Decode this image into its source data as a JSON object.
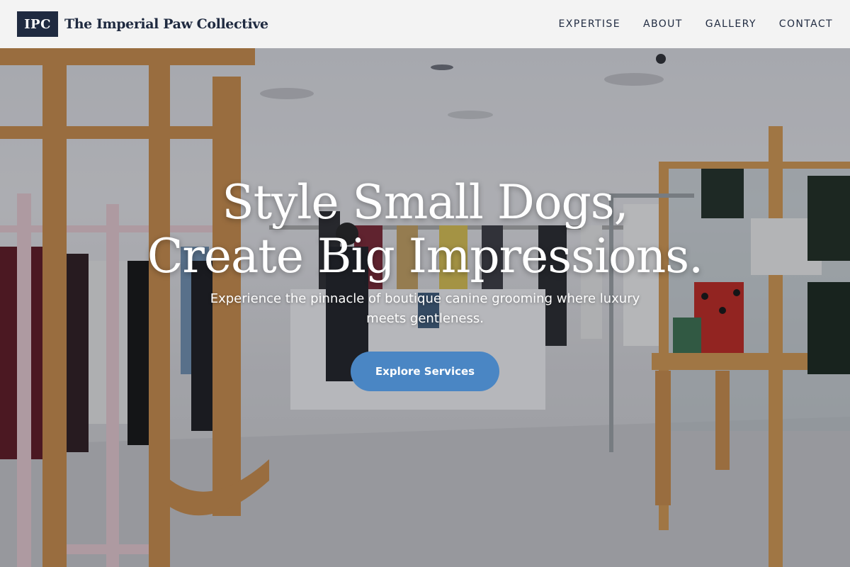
{
  "brand": {
    "logo_text": "IPC",
    "name": "The Imperial Paw Collective"
  },
  "nav": {
    "items": [
      "EXPERTISE",
      "ABOUT",
      "GALLERY",
      "CONTACT"
    ]
  },
  "hero": {
    "headline_line1": "Style Small Dogs,",
    "headline_line2": "Create Big Impressions.",
    "subhead": "Experience the pinnacle of boutique canine grooming where luxury meets gentleness.",
    "cta_label": "Explore Services",
    "image_subject": "boutique clothing store interior"
  },
  "colors": {
    "brand_navy": "#1f2a40",
    "cta_blue": "#4a86c4",
    "header_bg": "#f3f3f3"
  }
}
